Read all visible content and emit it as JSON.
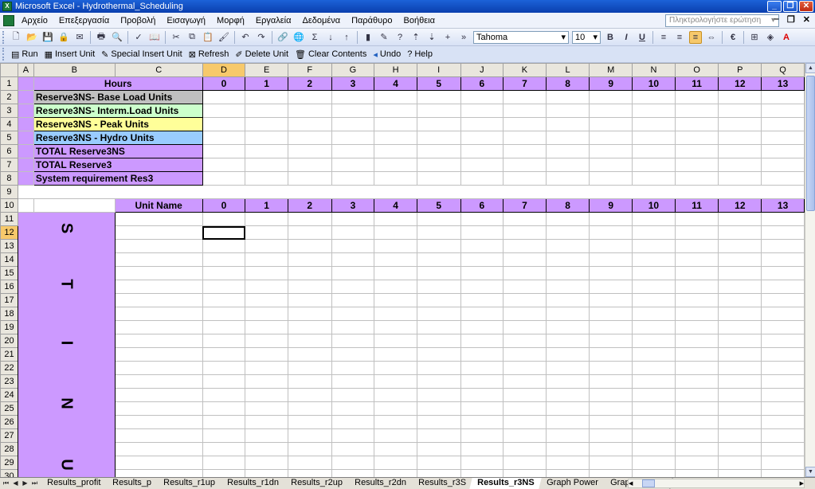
{
  "window": {
    "title": "Microsoft Excel - Hydrothermal_Scheduling"
  },
  "menu": {
    "items": [
      "Αρχείο",
      "Επεξεργασία",
      "Προβολή",
      "Εισαγωγή",
      "Μορφή",
      "Εργαλεία",
      "Δεδομένα",
      "Παράθυρο",
      "Βοήθεια"
    ],
    "help_placeholder": "Πληκτρολογήστε ερώτηση"
  },
  "formatting": {
    "font": "Tahoma",
    "size": "10"
  },
  "macro_toolbar": {
    "run": "Run",
    "insert_unit": "Insert Unit",
    "special_insert_unit": "Special Insert Unit",
    "refresh": "Refresh",
    "delete_unit": "Delete Unit",
    "clear_contents": "Clear Contents",
    "undo": "Undo",
    "help": "Help"
  },
  "sheet": {
    "columns": [
      "A",
      "B",
      "C",
      "D",
      "E",
      "F",
      "G",
      "H",
      "I",
      "J",
      "K",
      "L",
      "M",
      "N",
      "O",
      "P",
      "Q"
    ],
    "hours_label": "Hours",
    "hours": [
      "0",
      "1",
      "2",
      "3",
      "4",
      "5",
      "6",
      "7",
      "8",
      "9",
      "10",
      "11",
      "12",
      "13"
    ],
    "reserve_rows": [
      {
        "label": "Reserve3NS- Base Load Units",
        "color": "#c0c0c0"
      },
      {
        "label": "Reserve3NS- Interm.Load Units",
        "color": "#ccffcc"
      },
      {
        "label": "Reserve3NS - Peak Units",
        "color": "#ffff99"
      },
      {
        "label": "Reserve3NS - Hydro Units",
        "color": "#99ccff"
      },
      {
        "label": "TOTAL Reserve3NS",
        "color": "#cc99ff"
      },
      {
        "label": "TOTAL Reserve3",
        "color": "#cc99ff"
      },
      {
        "label": "System requirement Res3",
        "color": "#cc99ff"
      }
    ],
    "unit_name_label": "Unit Name",
    "units_letters": [
      "S",
      "T",
      "I",
      "N",
      "U"
    ],
    "row_numbers": [
      "1",
      "2",
      "3",
      "4",
      "5",
      "6",
      "7",
      "8",
      "9",
      "10",
      "11",
      "12",
      "13",
      "14",
      "15",
      "16",
      "17",
      "18",
      "19",
      "20",
      "21",
      "22",
      "23",
      "24",
      "25",
      "26",
      "27",
      "28",
      "29",
      "30"
    ],
    "selected_cell": "D12"
  },
  "tabs": [
    "Results_profit",
    "Results_p",
    "Results_r1up",
    "Results_r1dn",
    "Results_r2up",
    "Results_r2dn",
    "Results_r3S",
    "Results_r3NS",
    "Graph Power",
    "Graph Reserv"
  ],
  "active_tab": "Results_r3NS",
  "colors": {
    "purple": "#cc99ff",
    "select_header": "#f7c96b",
    "title_bar": "#0a3fae"
  }
}
